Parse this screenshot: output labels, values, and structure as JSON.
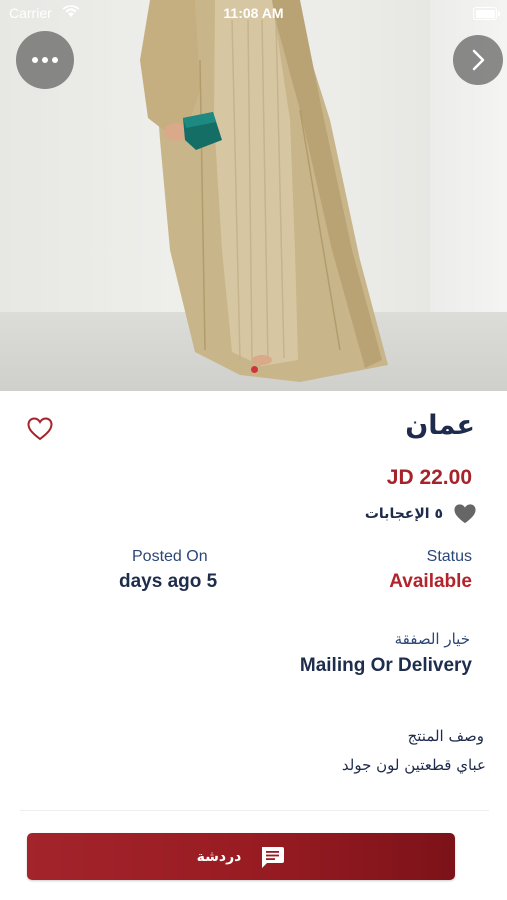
{
  "status_bar": {
    "carrier": "Carrier",
    "time": "11:08 AM",
    "wifi_icon": "wifi-icon",
    "battery_icon": "battery-icon"
  },
  "gallery": {
    "more_icon": "more-horizontal-icon",
    "next_icon": "chevron-right-icon",
    "page_indicator_color": "#d0343a"
  },
  "listing": {
    "title": "عمان",
    "price": "JD 22.00",
    "likes_text": "٥ الإعجابات",
    "posted_on_label": "Posted On",
    "posted_on_value": "days ago 5",
    "status_label": "Status",
    "status_value": "Available",
    "deal_option_label": "خيار الصفقة",
    "deal_option_value": "Mailing Or Delivery",
    "description_label": "وصف المنتج",
    "description_value": "عباي قطعتين لون جولد"
  },
  "actions": {
    "chat_label": "دردشة",
    "chat_icon": "chat-message-icon",
    "favorite_icon": "heart-outline-icon"
  },
  "colors": {
    "accent": "#a5232a",
    "title": "#1e2b4c",
    "button_start": "#a3242b",
    "button_end": "#7d1219"
  }
}
